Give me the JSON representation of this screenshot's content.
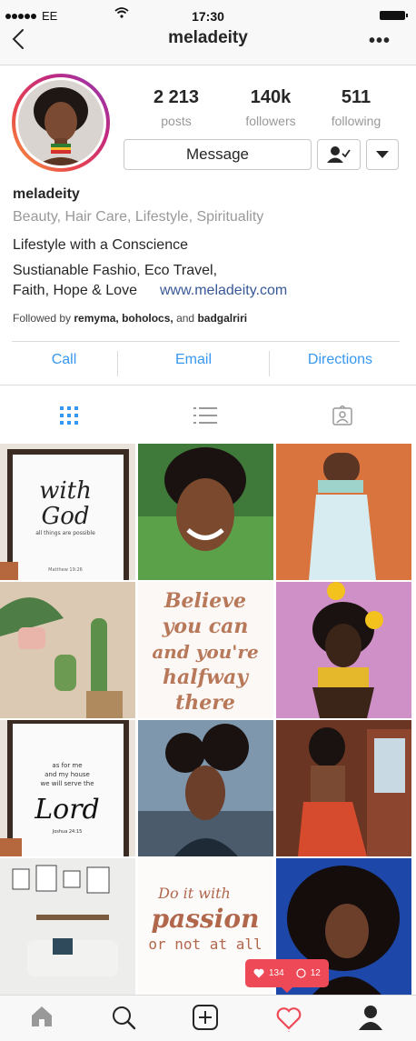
{
  "status_bar": {
    "carrier": "EE",
    "time": "17:30"
  },
  "header": {
    "username": "meladeity"
  },
  "profile": {
    "stats": [
      {
        "value": "2 213",
        "label": "posts"
      },
      {
        "value": "140k",
        "label": "followers"
      },
      {
        "value": "511",
        "label": "following"
      }
    ],
    "message_label": "Message",
    "name": "meladeity",
    "category": "Beauty, Hair Care, Lifestyle, Spirituality",
    "bio_line1": "Lifestyle with a Conscience",
    "bio_line2": "Sustianable Fashio, Eco Travel,",
    "bio_line3": "Faith, Hope & Love",
    "website": "www.meladeity.com",
    "followed_by_prefix": "Followed by ",
    "followed_by_names": "remyma, boholocs,",
    "followed_by_and": " and ",
    "followed_by_last": "badgalriri"
  },
  "contact": {
    "call": "Call",
    "email": "Email",
    "directions": "Directions"
  },
  "posts": {
    "p1_line1": "with",
    "p1_line2": "God",
    "p1_line3": "all things are possible",
    "p1_ref": "Matthew 19:26",
    "p5_line1": "Believe",
    "p5_line2": "you can",
    "p5_line3": "and you're",
    "p5_line4": "halfway",
    "p5_line5": "there",
    "p7_line1": "as for me",
    "p7_line2": "and my house",
    "p7_line3": "we will serve the",
    "p7_line4": "Lord",
    "p7_ref": "Joshua 24:15",
    "p11_line1": "Do it with",
    "p11_line2": "passion",
    "p11_line3": "or not at all"
  },
  "activity": {
    "likes": "134",
    "comments": "12"
  },
  "colors": {
    "accent": "#3897f0",
    "link": "#385898",
    "notification": "#ed4956"
  }
}
